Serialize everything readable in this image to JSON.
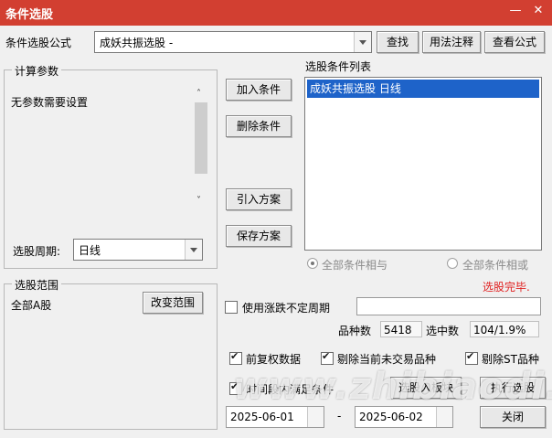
{
  "window": {
    "title": "条件选股"
  },
  "formula": {
    "label": "条件选股公式",
    "value": "成妖共振选股  -",
    "buttons": [
      "查找",
      "用法注释",
      "查看公式"
    ]
  },
  "params": {
    "legend": "计算参数",
    "message": "无参数需要设置",
    "period_label": "选股周期:",
    "period_value": "日线"
  },
  "scope": {
    "legend": "选股范围",
    "value": "全部A股",
    "change_button": "改变范围"
  },
  "actions": {
    "add": "加入条件",
    "delete": "删除条件",
    "import": "引入方案",
    "save": "保存方案"
  },
  "conditions": {
    "title": "选股条件列表",
    "items": [
      "成妖共振选股  日线"
    ]
  },
  "logic": {
    "and": "全部条件相与",
    "or": "全部条件相或",
    "status": "选股完毕."
  },
  "options": {
    "use_period": "使用涨跌不定周期",
    "count_label": "品种数",
    "count_value": "5418",
    "selected_label": "选中数",
    "selected_value": "104/1.9%",
    "forward_adjust": "前复权数据",
    "exclude_untraded": "剔除当前未交易品种",
    "exclude_st": "剔除ST品种",
    "time_range": "时间段内满足条件"
  },
  "dates": {
    "start": "2025-06-01",
    "end": "2025-06-02"
  },
  "bottom": {
    "to_block": "选股入板块",
    "run": "执行选股",
    "close": "关闭"
  },
  "watermark": "www.zhibiaodi.com",
  "colors": {
    "title_bar": "#d23f31",
    "selection": "#1e63c9",
    "status": "#e02020"
  }
}
